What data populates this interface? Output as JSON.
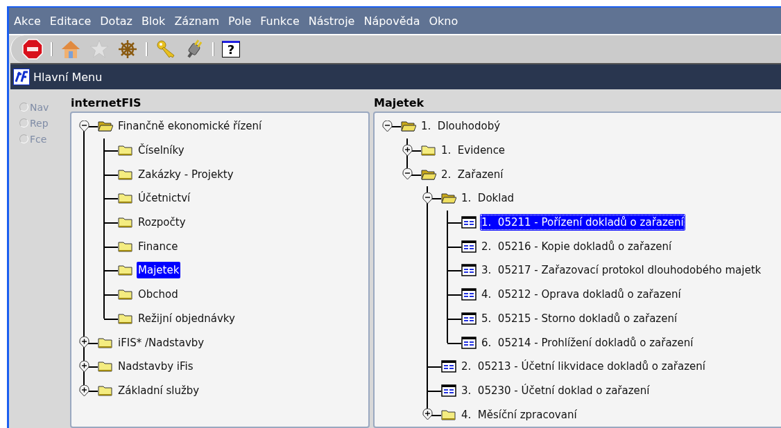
{
  "menu": [
    "Akce",
    "Editace",
    "Dotaz",
    "Blok",
    "Záznam",
    "Pole",
    "Funkce",
    "Nástroje",
    "Nápověda",
    "Okno"
  ],
  "toolbar": [
    {
      "kind": "exit"
    },
    {
      "kind": "separator"
    },
    {
      "kind": "home"
    },
    {
      "kind": "star",
      "disabled": true
    },
    {
      "kind": "wheel"
    },
    {
      "kind": "separator"
    },
    {
      "kind": "key"
    },
    {
      "kind": "plug"
    },
    {
      "kind": "separator"
    },
    {
      "kind": "help",
      "label": "?"
    }
  ],
  "window": {
    "title": "Hlavní Menu"
  },
  "radios": [
    {
      "label": "Nav",
      "selected": false,
      "disabled": true
    },
    {
      "label": "Rep",
      "selected": false,
      "disabled": true
    },
    {
      "label": "Fce",
      "selected": false,
      "disabled": true
    }
  ],
  "panels": [
    {
      "heading": "internetFIS",
      "tree": [
        {
          "label": "Finančně ekonomické řízení",
          "kind": "folder",
          "expanded": true,
          "selected": false,
          "children": [
            {
              "label": "Číselníky",
              "kind": "folder",
              "selected": false
            },
            {
              "label": "Zakázky - Projekty",
              "kind": "folder",
              "selected": false
            },
            {
              "label": "Účetnictví",
              "kind": "folder",
              "selected": false
            },
            {
              "label": "Rozpočty",
              "kind": "folder",
              "selected": false
            },
            {
              "label": "Finance",
              "kind": "folder",
              "selected": false
            },
            {
              "label": "Majetek",
              "kind": "folder",
              "selected": true
            },
            {
              "label": "Obchod",
              "kind": "folder",
              "selected": false
            },
            {
              "label": "Režijní objednávky",
              "kind": "folder",
              "selected": false
            }
          ]
        },
        {
          "label": "iFIS* /Nadstavby",
          "kind": "folder",
          "expanded": false,
          "selected": false
        },
        {
          "label": "Nadstavby iFis",
          "kind": "folder",
          "expanded": false,
          "selected": false
        },
        {
          "label": "Základní služby",
          "kind": "folder",
          "expanded": false,
          "selected": false
        }
      ]
    },
    {
      "heading": "Majetek",
      "tree": [
        {
          "label": "1.  Dlouhodobý",
          "kind": "folder",
          "expanded": true,
          "selected": false,
          "children": [
            {
              "label": "1.  Evidence",
              "kind": "folder",
              "expanded": false,
              "selected": false
            },
            {
              "label": "2.  Zařazení",
              "kind": "folder",
              "expanded": true,
              "selected": false,
              "children": [
                {
                  "label": "1.  Doklad",
                  "kind": "folder",
                  "expanded": true,
                  "selected": false,
                  "children": [
                    {
                      "label": "1.  05211 - Pořízení dokladů o zařazení",
                      "kind": "form",
                      "selected": true,
                      "focused": true
                    },
                    {
                      "label": "2.  05216 - Kopie dokladů o zařazení",
                      "kind": "form",
                      "selected": false
                    },
                    {
                      "label": "3.  05217 - Zařazovací protokol dlouhodobého majetk",
                      "kind": "form",
                      "selected": false
                    },
                    {
                      "label": "4.  05212 - Oprava dokladů o zařazení",
                      "kind": "form",
                      "selected": false
                    },
                    {
                      "label": "5.  05215 - Storno dokladů o zařazení",
                      "kind": "form",
                      "selected": false
                    },
                    {
                      "label": "6.  05214 - Prohlížení dokladů o zařazení",
                      "kind": "form",
                      "selected": false
                    }
                  ]
                },
                {
                  "label": "2.  05213 - Účetní likvidace dokladů o zařazení",
                  "kind": "form",
                  "selected": false
                },
                {
                  "label": "3.  05230 - Účetní doklad o zařazení",
                  "kind": "form",
                  "selected": false
                },
                {
                  "label": "4.  Měsíční zpracovaní",
                  "kind": "folder",
                  "expanded": false,
                  "selected": false
                }
              ]
            }
          ]
        }
      ]
    }
  ]
}
